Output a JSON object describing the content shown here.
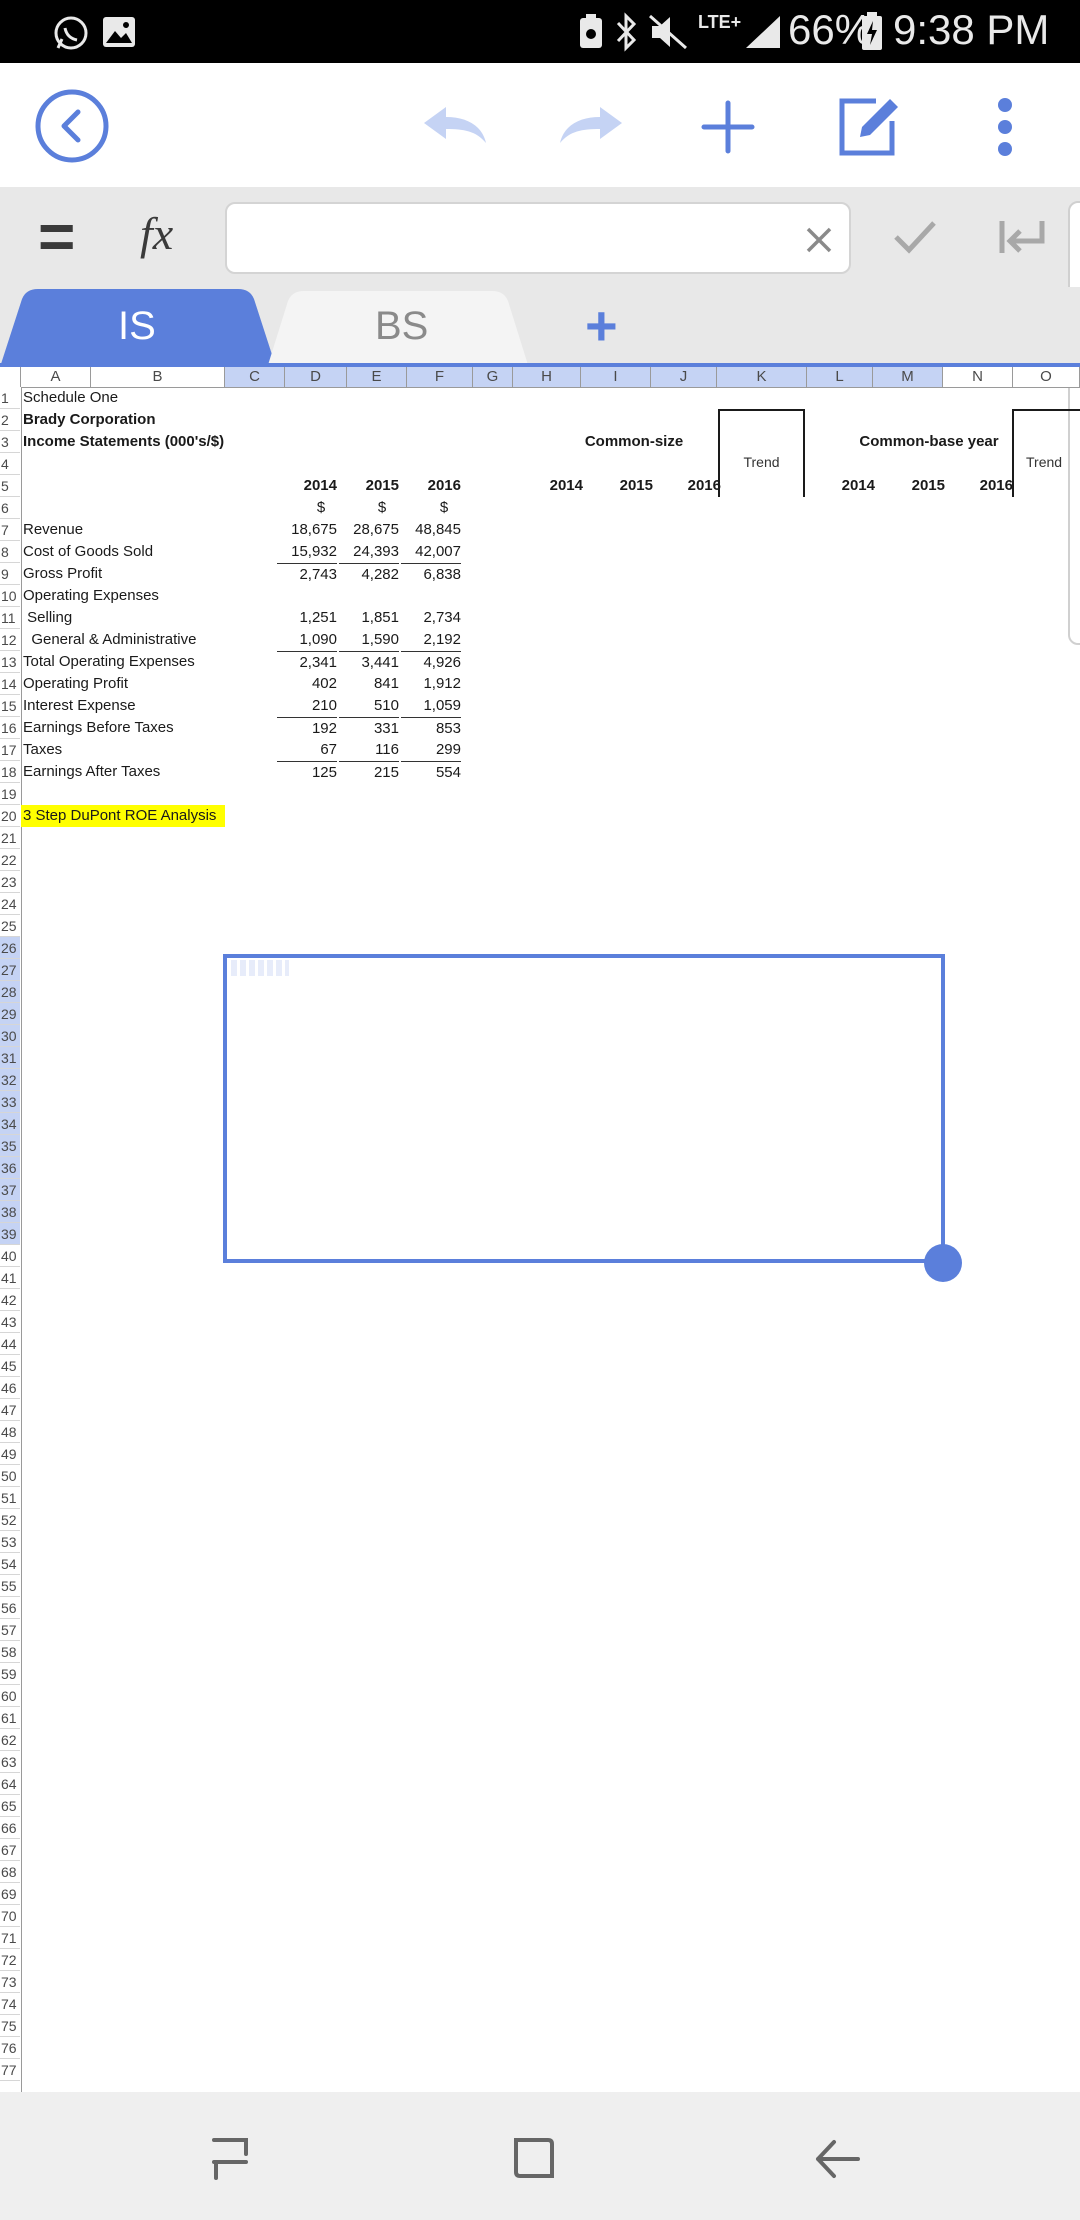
{
  "status_bar": {
    "battery": "66%",
    "time": "9:38 PM",
    "network": "LTE+",
    "icons": [
      "whatsapp-icon",
      "gallery-icon",
      "battery-saver-icon",
      "bluetooth-icon",
      "mute-icon",
      "signal-icon",
      "battery-icon"
    ]
  },
  "toolbar": {
    "icons": [
      "back-icon",
      "undo-icon",
      "redo-icon",
      "add-icon",
      "edit-icon",
      "more-icon"
    ],
    "accent": "#5b7fdb",
    "disabled": "#c5d3f4"
  },
  "formula_bar": {
    "equals_symbol": "=",
    "fx_label": "fx",
    "input_value": "",
    "icons": [
      "clear-icon",
      "confirm-icon",
      "enter-icon"
    ]
  },
  "tabs": [
    {
      "label": "IS",
      "active": true
    },
    {
      "label": "BS",
      "active": false
    }
  ],
  "add_sheet_label": "+",
  "columns": [
    "A",
    "B",
    "C",
    "D",
    "E",
    "F",
    "G",
    "H",
    "I",
    "J",
    "K",
    "L",
    "M",
    "N",
    "O"
  ],
  "sheet": {
    "schedule": "Schedule One",
    "company": "Brady Corporation",
    "statement": "Income Statements (000's/$)",
    "common_size": "Common-size",
    "common_base": "Common-base year",
    "trend": "Trend",
    "trend2": "Trend",
    "years": [
      "2014",
      "2015",
      "2016"
    ],
    "cs_years": [
      "2014",
      "2015",
      "2016"
    ],
    "cb_years": [
      "2014",
      "2015",
      "2016"
    ],
    "currency": [
      "$",
      "$",
      "$"
    ],
    "rows": [
      {
        "label": "Revenue",
        "values": [
          "18,675",
          "28,675",
          "48,845"
        ]
      },
      {
        "label": "Cost of Goods Sold",
        "values": [
          "15,932",
          "24,393",
          "42,007"
        ]
      },
      {
        "label": "Gross Profit",
        "values": [
          "2,743",
          "4,282",
          "6,838"
        ]
      },
      {
        "label": "Operating Expenses",
        "values": [
          "",
          "",
          ""
        ]
      },
      {
        "label": " Selling",
        "values": [
          "1,251",
          "1,851",
          "2,734"
        ]
      },
      {
        "label": "  General & Administrative",
        "values": [
          "1,090",
          "1,590",
          "2,192"
        ]
      },
      {
        "label": "Total Operating Expenses",
        "values": [
          "2,341",
          "3,441",
          "4,926"
        ]
      },
      {
        "label": "Operating Profit",
        "values": [
          "402",
          "841",
          "1,912"
        ]
      },
      {
        "label": "Interest Expense",
        "values": [
          "210",
          "510",
          "1,059"
        ]
      },
      {
        "label": "Earnings Before Taxes",
        "values": [
          "192",
          "331",
          "853"
        ]
      },
      {
        "label": "Taxes",
        "values": [
          "67",
          "116",
          "299"
        ]
      },
      {
        "label": "Earnings After Taxes",
        "values": [
          "125",
          "215",
          "554"
        ]
      }
    ],
    "dupont_label": "3 Step DuPont ROE Analysis",
    "highlight_color": "#ffff00"
  },
  "row_numbers_first": 1,
  "row_numbers_last": 77,
  "selected_rows": [
    26,
    27,
    28,
    29,
    30,
    31,
    32,
    33,
    34,
    35,
    36,
    37,
    38,
    39
  ],
  "selected_columns": [
    "C",
    "D",
    "E",
    "F",
    "G",
    "H",
    "I",
    "J",
    "K",
    "L",
    "M"
  ],
  "nav_bar": {
    "icons": [
      "recent-apps-icon",
      "home-icon",
      "back-nav-icon"
    ]
  }
}
